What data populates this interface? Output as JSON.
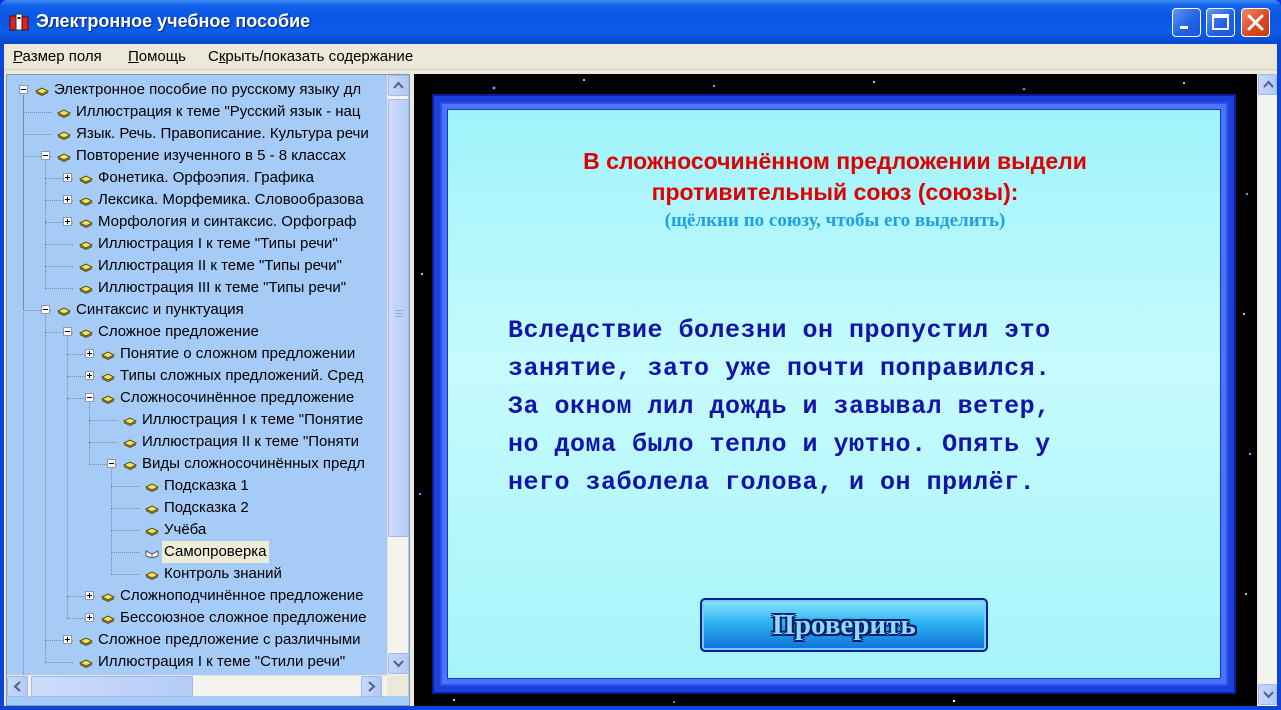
{
  "window": {
    "title": "Электронное учебное пособие"
  },
  "menu": {
    "items": [
      {
        "label": "Размер поля"
      },
      {
        "label": "Помощь"
      },
      {
        "label": "Скрыть/показать содержание"
      }
    ]
  },
  "tree": {
    "rows": [
      {
        "label": "Электронное пособие по русскому языку дл"
      },
      {
        "label": "Иллюстрация к теме \"Русский язык - нац"
      },
      {
        "label": "Язык. Речь. Правописание. Культура речи"
      },
      {
        "label": "Повторение изученного в 5 - 8 классах"
      },
      {
        "label": "Фонетика. Орфоэпия. Графика"
      },
      {
        "label": "Лексика. Морфемика. Словообразова"
      },
      {
        "label": "Морфология и синтаксис. Орфограф"
      },
      {
        "label": "Иллюстрация I к теме \"Типы речи\""
      },
      {
        "label": "Иллюстрация II к теме \"Типы речи\""
      },
      {
        "label": "Иллюстрация III к теме \"Типы речи\""
      },
      {
        "label": "Синтаксис и пунктуация"
      },
      {
        "label": "Сложное предложение"
      },
      {
        "label": "Понятие о сложном предложении"
      },
      {
        "label": "Типы сложных предложений. Сред"
      },
      {
        "label": "Сложносочинённое предложение"
      },
      {
        "label": "Иллюстрация I к теме \"Понятие"
      },
      {
        "label": "Иллюстрация II к теме \"Поняти"
      },
      {
        "label": "Виды сложносочинённых предл"
      },
      {
        "label": "Подсказка 1"
      },
      {
        "label": "Подсказка 2"
      },
      {
        "label": "Учёба"
      },
      {
        "label": "Самопроверка"
      },
      {
        "label": "Контроль знаний"
      },
      {
        "label": "Сложноподчинённое предложение"
      },
      {
        "label": "Бессоюзное сложное предложение"
      },
      {
        "label": "Сложное предложение с различными"
      },
      {
        "label": "Иллюстрация I к теме \"Стили речи\""
      }
    ]
  },
  "exercise": {
    "heading_line1": "В сложносочинённом предложении выдели",
    "heading_line2": "противительный союз (союзы):",
    "subheading": "(щёлкни по союзу, чтобы его выделить)",
    "passage_lines": [
      "Вследствие болезни он пропустил это",
      "занятие, зато уже почти поправился.",
      "За окном лил дождь и завывал ветер,",
      "но дома было тепло и уютно. Опять у",
      "него заболела голова, и он прилёг."
    ],
    "check_button": "Проверить"
  },
  "colors": {
    "heading": "#e00000",
    "subheading": "#1ea0e6",
    "passage": "#1414a8",
    "tree_background": "#a6cbf7"
  },
  "icons": {
    "tree_node": "book-icon",
    "tree_node_open": "open-book-icon"
  }
}
